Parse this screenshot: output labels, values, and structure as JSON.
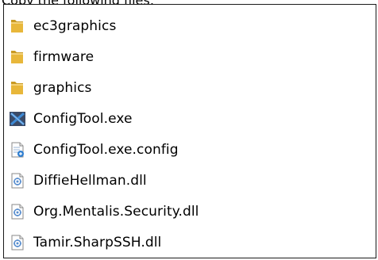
{
  "caption": "Copy the following files:",
  "files": [
    {
      "name": "ec3graphics",
      "icon": "folder-icon",
      "type": "folder"
    },
    {
      "name": "firmware",
      "icon": "folder-icon",
      "type": "folder"
    },
    {
      "name": "graphics",
      "icon": "folder-icon",
      "type": "folder"
    },
    {
      "name": "ConfigTool.exe",
      "icon": "app-x-icon",
      "type": "exe"
    },
    {
      "name": "ConfigTool.exe.config",
      "icon": "config-file-icon",
      "type": "config"
    },
    {
      "name": "DiffieHellman.dll",
      "icon": "dll-file-icon",
      "type": "dll"
    },
    {
      "name": "Org.Mentalis.Security.dll",
      "icon": "dll-file-icon",
      "type": "dll"
    },
    {
      "name": "Tamir.SharpSSH.dll",
      "icon": "dll-file-icon",
      "type": "dll"
    }
  ],
  "colors": {
    "folder_front": "#e8b73a",
    "folder_back": "#c99a22",
    "exe_dark": "#3b4a66",
    "exe_blue": "#3d8ad6",
    "dll_blue": "#5a8fcf"
  }
}
